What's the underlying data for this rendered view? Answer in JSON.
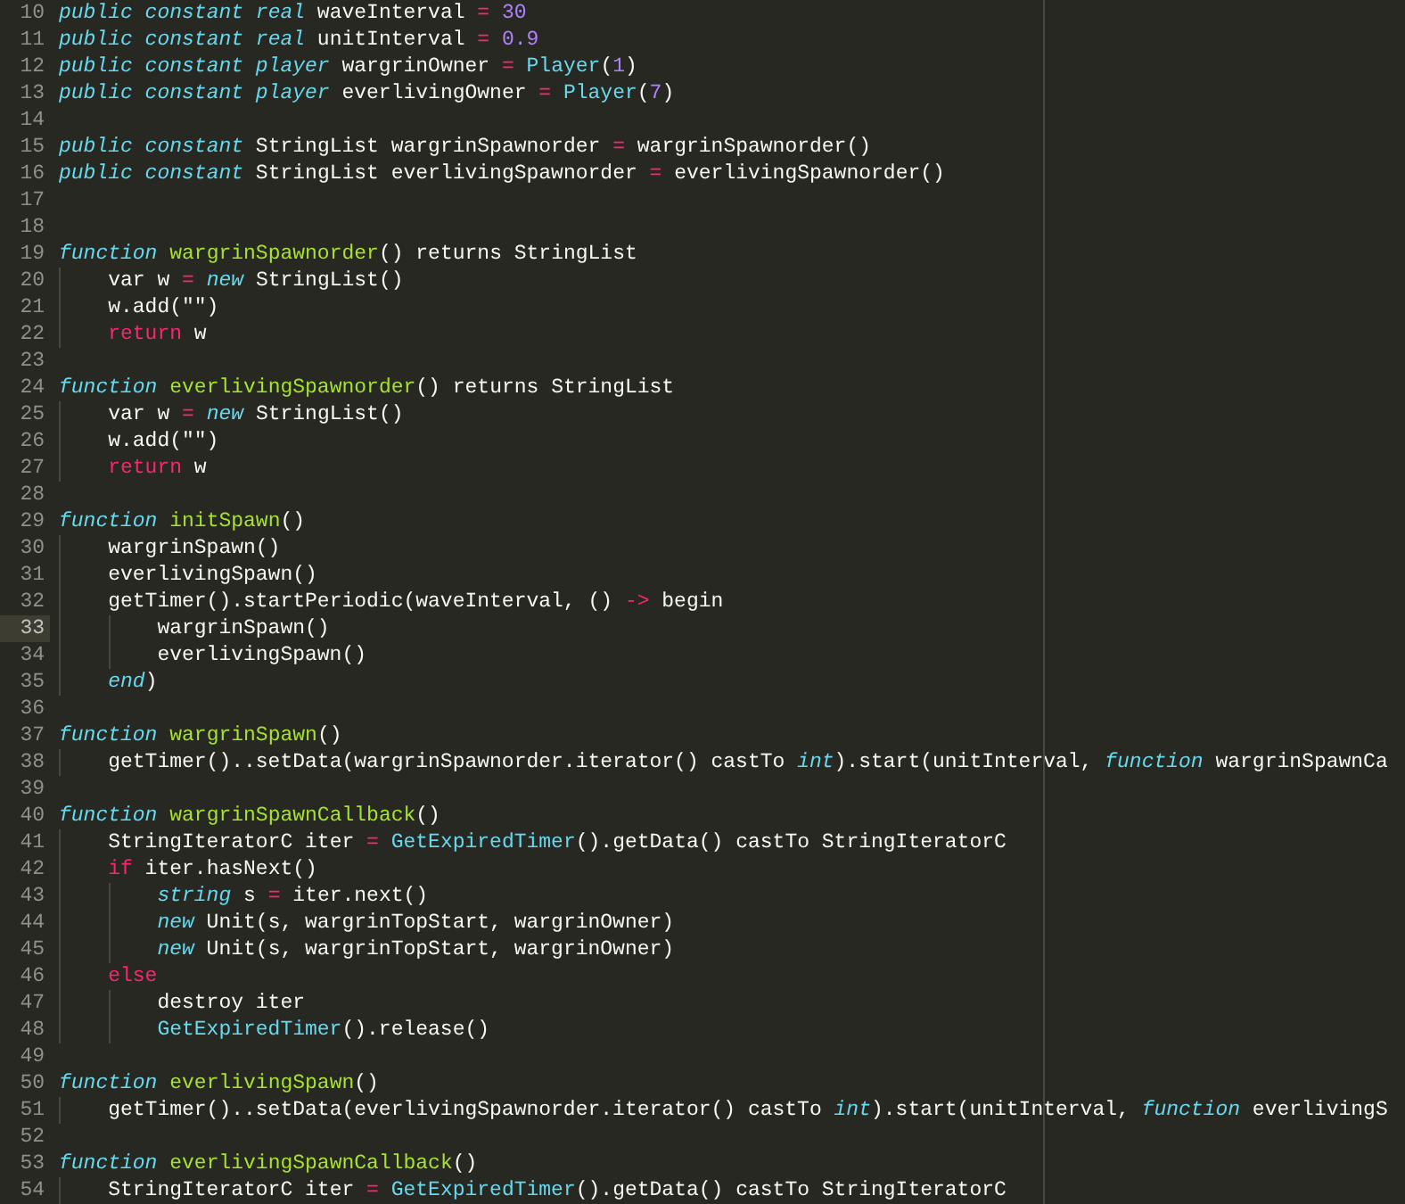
{
  "editor": {
    "lines": [
      {
        "number": "10",
        "selected": false,
        "tokens": [
          {
            "kind": "keyword",
            "text": "public constant real"
          },
          {
            "kind": "plain",
            "text": " waveInterval"
          },
          {
            "kind": "operator",
            "text": " = "
          },
          {
            "kind": "number",
            "text": "30"
          }
        ]
      },
      {
        "number": "11",
        "selected": false,
        "tokens": [
          {
            "kind": "keyword",
            "text": "public constant real"
          },
          {
            "kind": "plain",
            "text": " unitInterval"
          },
          {
            "kind": "operator",
            "text": " = "
          },
          {
            "kind": "number",
            "text": "0.9"
          }
        ]
      },
      {
        "number": "12",
        "selected": false,
        "tokens": [
          {
            "kind": "keyword",
            "text": "public constant player"
          },
          {
            "kind": "plain",
            "text": " wargrinOwner"
          },
          {
            "kind": "operator",
            "text": " = "
          },
          {
            "kind": "builtin",
            "text": "Player"
          },
          {
            "kind": "plain",
            "text": "("
          },
          {
            "kind": "number",
            "text": "1"
          },
          {
            "kind": "plain",
            "text": ")"
          }
        ]
      },
      {
        "number": "13",
        "selected": false,
        "tokens": [
          {
            "kind": "keyword",
            "text": "public constant player"
          },
          {
            "kind": "plain",
            "text": " everlivingOwner"
          },
          {
            "kind": "operator",
            "text": " = "
          },
          {
            "kind": "builtin",
            "text": "Player"
          },
          {
            "kind": "plain",
            "text": "("
          },
          {
            "kind": "number",
            "text": "7"
          },
          {
            "kind": "plain",
            "text": ")"
          }
        ]
      },
      {
        "number": "14",
        "selected": false
      },
      {
        "number": "15",
        "selected": false,
        "tokens": [
          {
            "kind": "keyword",
            "text": "public constant"
          },
          {
            "kind": "plain",
            "text": " StringList wargrinSpawnorder"
          },
          {
            "kind": "operator",
            "text": " = "
          },
          {
            "kind": "plain",
            "text": "wargrinSpawnorder()"
          }
        ]
      },
      {
        "number": "16",
        "selected": false,
        "tokens": [
          {
            "kind": "keyword",
            "text": "public constant"
          },
          {
            "kind": "plain",
            "text": " StringList everlivingSpawnorder"
          },
          {
            "kind": "operator",
            "text": " = "
          },
          {
            "kind": "plain",
            "text": "everlivingSpawnorder()"
          }
        ]
      },
      {
        "number": "17",
        "selected": false
      },
      {
        "number": "18",
        "selected": false
      },
      {
        "number": "19",
        "selected": false,
        "tokens": [
          {
            "kind": "keyword",
            "text": "function"
          },
          {
            "kind": "name",
            "text": " wargrinSpawnorder"
          },
          {
            "kind": "plain",
            "text": "() returns StringList"
          }
        ]
      },
      {
        "number": "20",
        "selected": false,
        "tokens": [
          {
            "kind": "plain",
            "text": "    var w"
          },
          {
            "kind": "operator",
            "text": " = "
          },
          {
            "kind": "keyword",
            "text": "new"
          },
          {
            "kind": "plain",
            "text": " StringList()"
          }
        ]
      },
      {
        "number": "21",
        "selected": false,
        "tokens": [
          {
            "kind": "plain",
            "text": "    w.add(\"\")"
          }
        ]
      },
      {
        "number": "22",
        "selected": false,
        "tokens": [
          {
            "kind": "control",
            "text": "    return"
          },
          {
            "kind": "plain",
            "text": " w"
          }
        ]
      },
      {
        "number": "23",
        "selected": false
      },
      {
        "number": "24",
        "selected": false,
        "tokens": [
          {
            "kind": "keyword",
            "text": "function"
          },
          {
            "kind": "name",
            "text": " everlivingSpawnorder"
          },
          {
            "kind": "plain",
            "text": "() returns StringList"
          }
        ]
      },
      {
        "number": "25",
        "selected": false,
        "tokens": [
          {
            "kind": "plain",
            "text": "    var w"
          },
          {
            "kind": "operator",
            "text": " = "
          },
          {
            "kind": "keyword",
            "text": "new"
          },
          {
            "kind": "plain",
            "text": " StringList()"
          }
        ]
      },
      {
        "number": "26",
        "selected": false,
        "tokens": [
          {
            "kind": "plain",
            "text": "    w.add(\"\")"
          }
        ]
      },
      {
        "number": "27",
        "selected": false,
        "tokens": [
          {
            "kind": "control",
            "text": "    return"
          },
          {
            "kind": "plain",
            "text": " w"
          }
        ]
      },
      {
        "number": "28",
        "selected": false
      },
      {
        "number": "29",
        "selected": false,
        "tokens": [
          {
            "kind": "keyword",
            "text": "function"
          },
          {
            "kind": "name",
            "text": " initSpawn"
          },
          {
            "kind": "plain",
            "text": "()"
          }
        ]
      },
      {
        "number": "30",
        "selected": false,
        "tokens": [
          {
            "kind": "plain",
            "text": "    wargrinSpawn()"
          }
        ]
      },
      {
        "number": "31",
        "selected": false,
        "tokens": [
          {
            "kind": "plain",
            "text": "    everlivingSpawn()"
          }
        ]
      },
      {
        "number": "32",
        "selected": false,
        "tokens": [
          {
            "kind": "plain",
            "text": "    getTimer().startPeriodic(waveInterval, ()"
          },
          {
            "kind": "operator",
            "text": " -> "
          },
          {
            "kind": "plain",
            "text": "begin"
          }
        ]
      },
      {
        "number": "33",
        "selected": true,
        "tokens": [
          {
            "kind": "plain",
            "text": "        wargrinSpawn()"
          }
        ]
      },
      {
        "number": "34",
        "selected": false,
        "tokens": [
          {
            "kind": "plain",
            "text": "        everlivingSpawn()"
          }
        ]
      },
      {
        "number": "35",
        "selected": false,
        "tokens": [
          {
            "kind": "keyword",
            "text": "    end"
          },
          {
            "kind": "plain",
            "text": ")"
          }
        ]
      },
      {
        "number": "36",
        "selected": false
      },
      {
        "number": "37",
        "selected": false,
        "tokens": [
          {
            "kind": "keyword",
            "text": "function"
          },
          {
            "kind": "name",
            "text": " wargrinSpawn"
          },
          {
            "kind": "plain",
            "text": "()"
          }
        ]
      },
      {
        "number": "38",
        "selected": false,
        "tokens": [
          {
            "kind": "plain",
            "text": "    getTimer()..setData(wargrinSpawnorder.iterator() castTo "
          },
          {
            "kind": "keyword",
            "text": "int"
          },
          {
            "kind": "plain",
            "text": ").start(unitInterval, "
          },
          {
            "kind": "keyword",
            "text": "function"
          },
          {
            "kind": "plain",
            "text": " wargrinSpawnCa"
          }
        ]
      },
      {
        "number": "39",
        "selected": false
      },
      {
        "number": "40",
        "selected": false,
        "tokens": [
          {
            "kind": "keyword",
            "text": "function"
          },
          {
            "kind": "name",
            "text": " wargrinSpawnCallback"
          },
          {
            "kind": "plain",
            "text": "()"
          }
        ]
      },
      {
        "number": "41",
        "selected": false,
        "tokens": [
          {
            "kind": "plain",
            "text": "    StringIteratorC iter"
          },
          {
            "kind": "operator",
            "text": " = "
          },
          {
            "kind": "builtin",
            "text": "GetExpiredTimer"
          },
          {
            "kind": "plain",
            "text": "().getData() castTo StringIteratorC"
          }
        ]
      },
      {
        "number": "42",
        "selected": false,
        "tokens": [
          {
            "kind": "control",
            "text": "    if"
          },
          {
            "kind": "plain",
            "text": " iter.hasNext()"
          }
        ]
      },
      {
        "number": "43",
        "selected": false,
        "tokens": [
          {
            "kind": "keyword",
            "text": "        string"
          },
          {
            "kind": "plain",
            "text": " s"
          },
          {
            "kind": "operator",
            "text": " = "
          },
          {
            "kind": "plain",
            "text": "iter.next()"
          }
        ]
      },
      {
        "number": "44",
        "selected": false,
        "tokens": [
          {
            "kind": "keyword",
            "text": "        new"
          },
          {
            "kind": "plain",
            "text": " Unit(s, wargrinTopStart, wargrinOwner)"
          }
        ]
      },
      {
        "number": "45",
        "selected": false,
        "tokens": [
          {
            "kind": "keyword",
            "text": "        new"
          },
          {
            "kind": "plain",
            "text": " Unit(s, wargrinTopStart, wargrinOwner)"
          }
        ]
      },
      {
        "number": "46",
        "selected": false,
        "tokens": [
          {
            "kind": "control",
            "text": "    else"
          }
        ]
      },
      {
        "number": "47",
        "selected": false,
        "tokens": [
          {
            "kind": "plain",
            "text": "        destroy iter"
          }
        ]
      },
      {
        "number": "48",
        "selected": false,
        "tokens": [
          {
            "kind": "builtin",
            "text": "        GetExpiredTimer"
          },
          {
            "kind": "plain",
            "text": "().release()"
          }
        ]
      },
      {
        "number": "49",
        "selected": false
      },
      {
        "number": "50",
        "selected": false,
        "tokens": [
          {
            "kind": "keyword",
            "text": "function"
          },
          {
            "kind": "name",
            "text": " everlivingSpawn"
          },
          {
            "kind": "plain",
            "text": "()"
          }
        ]
      },
      {
        "number": "51",
        "selected": false,
        "tokens": [
          {
            "kind": "plain",
            "text": "    getTimer()..setData(everlivingSpawnorder.iterator() castTo "
          },
          {
            "kind": "keyword",
            "text": "int"
          },
          {
            "kind": "plain",
            "text": ").start(unitInterval, "
          },
          {
            "kind": "keyword",
            "text": "function"
          },
          {
            "kind": "plain",
            "text": " everlivingS"
          }
        ]
      },
      {
        "number": "52",
        "selected": false
      },
      {
        "number": "53",
        "selected": false,
        "tokens": [
          {
            "kind": "keyword",
            "text": "function"
          },
          {
            "kind": "name",
            "text": " everlivingSpawnCallback"
          },
          {
            "kind": "plain",
            "text": "()"
          }
        ]
      },
      {
        "number": "54",
        "selected": false,
        "tokens": [
          {
            "kind": "plain",
            "text": "    StringIteratorC iter"
          },
          {
            "kind": "operator",
            "text": " = "
          },
          {
            "kind": "builtin",
            "text": "GetExpiredTimer"
          },
          {
            "kind": "plain",
            "text": "().getData() castTo StringIteratorC"
          }
        ]
      }
    ]
  }
}
